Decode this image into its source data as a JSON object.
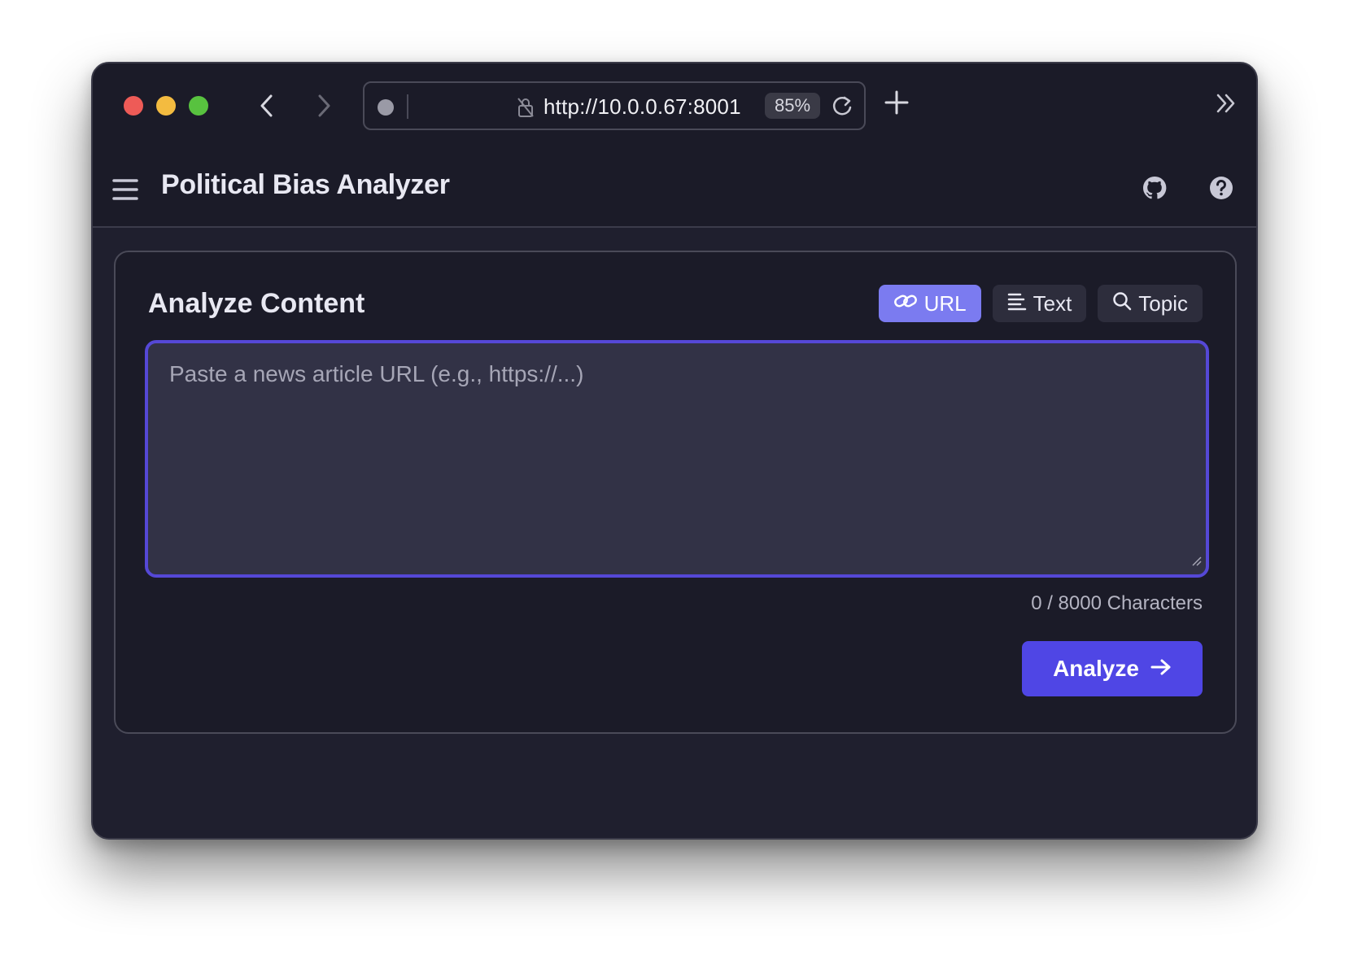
{
  "browser": {
    "url": "http://10.0.0.67:8001",
    "zoom": "85%",
    "icons": [
      "back-icon",
      "forward-icon",
      "lock-icon",
      "reload-icon",
      "new-tab-icon",
      "overflow-icon"
    ]
  },
  "header": {
    "title": "Political Bias Analyzer",
    "icons": [
      "hamburger-icon",
      "github-icon",
      "help-icon"
    ]
  },
  "card": {
    "title": "Analyze Content",
    "tabs": [
      {
        "label": "URL",
        "icon": "link-icon",
        "active": true
      },
      {
        "label": "Text",
        "icon": "text-lines-icon",
        "active": false
      },
      {
        "label": "Topic",
        "icon": "search-icon",
        "active": false
      }
    ],
    "input": {
      "placeholder": "Paste a news article URL (e.g., https://...)",
      "value": ""
    },
    "char_count": "0 / 8000 Characters",
    "analyze_label": "Analyze"
  },
  "colors": {
    "accent": "#4f46e5",
    "tab_active": "#7b7bf0",
    "background": "#1e1e2c"
  }
}
